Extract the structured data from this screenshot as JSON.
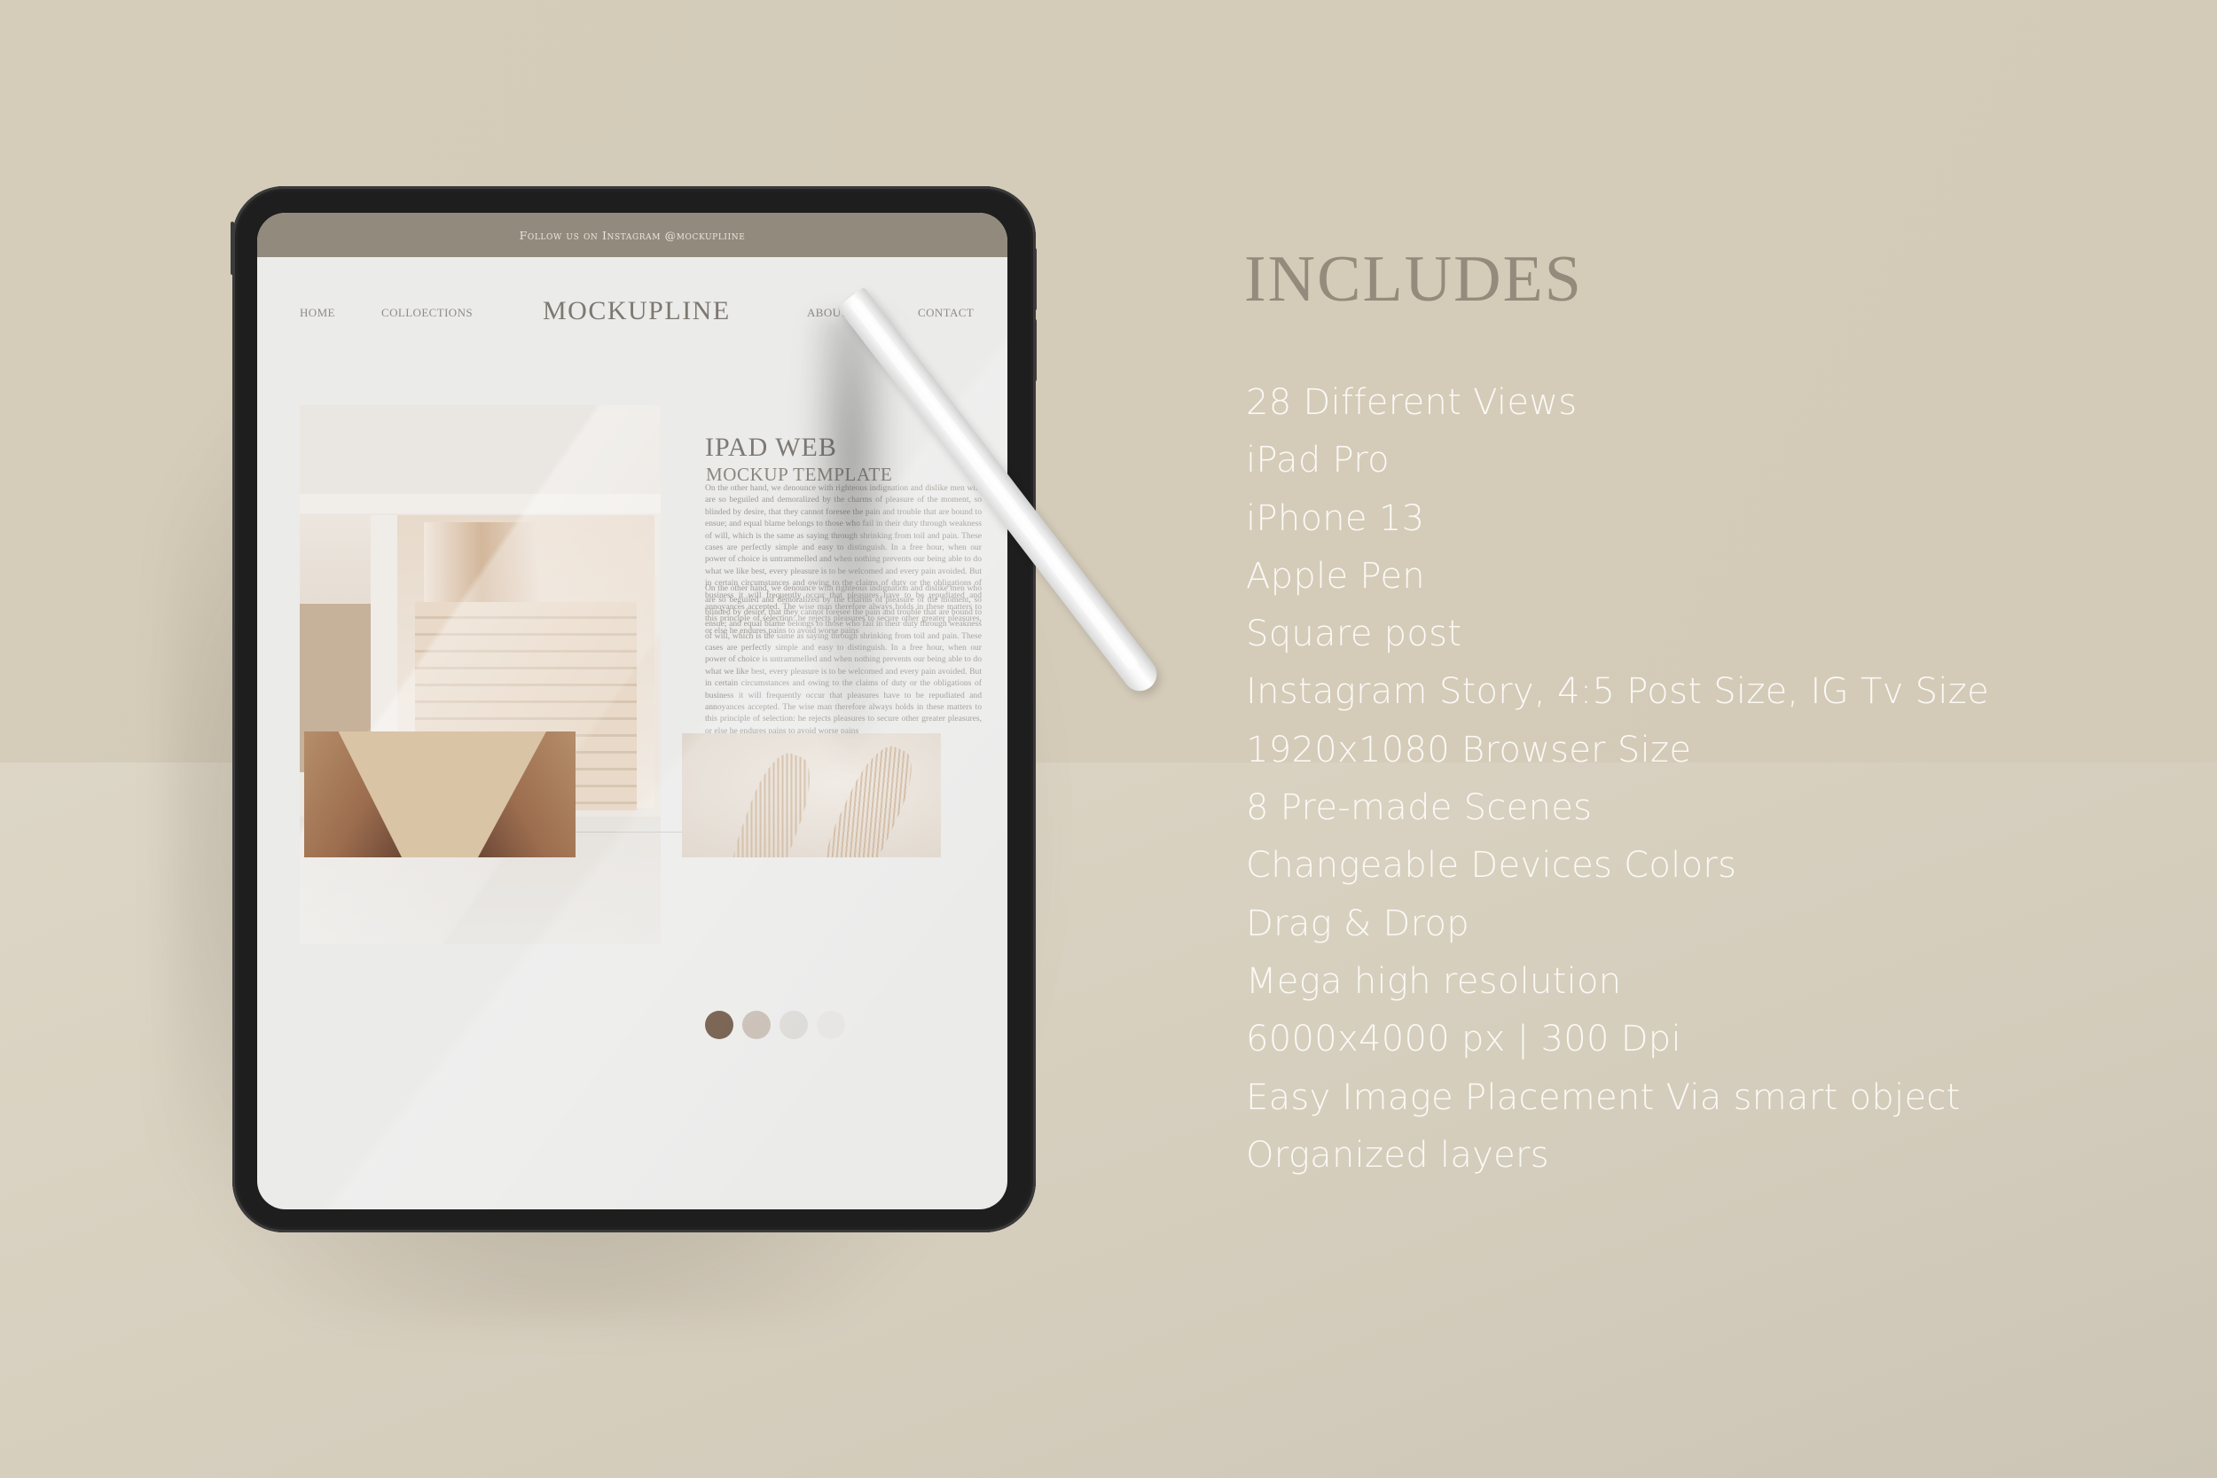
{
  "colors": {
    "background_top": "#d4cbb9",
    "background_bottom": "#ddd6c6",
    "device_frame": "#1e1e1e",
    "banner": "#928a7d",
    "title_text": "#948b7d",
    "feature_text": "#fbf9f5",
    "swatches": [
      "#6e5644",
      "#c7bdb3",
      "#dcdad6",
      "#e6e5e3"
    ]
  },
  "device": {
    "type": "iPad Pro",
    "website": {
      "banner_text": "Follow us on Instagram @mockupliine",
      "nav": {
        "left": [
          "HOME",
          "COLLOECTIONS"
        ],
        "logo": "MOCKUPLINE",
        "right": [
          "ABOUT US",
          "CONTACT"
        ]
      },
      "hero": {
        "title": "IPAD WEB",
        "subtitle": "MOCKUP TEMPLATE",
        "paragraphs": [
          "On the other hand, we denounce with righteous indignation and dislike men who are so beguiled and demoralized by the charms of pleasure of the moment, so blinded by desire, that they cannot foresee the pain and trouble that are bound to ensue; and equal blame belongs to those who fail in their duty through weakness of will, which is the same as saying through shrinking from toil and pain. These cases are perfectly simple and easy to distinguish. In a free hour, when our power of choice is untrammelled and when nothing prevents our being able to do what we like best, every pleasure is to be welcomed and every pain avoided. But in certain circumstances and owing to the claims of duty or the obligations of business it will frequently occur that pleasures have to be repudiated and annoyances accepted. The wise man therefore always holds in these matters to this principle of selection: he rejects pleasures to secure other greater pleasures, or else he endures pains to avoid worse pains",
          "On the other hand, we denounce with righteous indignation and dislike men who are so beguiled and demoralized by the charms of pleasure of the moment, so blinded by desire, that they cannot foresee the pain and trouble that are bound to ensue; and equal blame belongs to those who fail in their duty through weakness of will, which is the same as saying through shrinking from toil and pain. These cases are perfectly simple and easy to distinguish. In a free hour, when our power of choice is untrammelled and when nothing prevents our being able to do what we like best, every pleasure is to be welcomed and every pain avoided. But in certain circumstances and owing to the claims of duty or the obligations of business it will frequently occur that pleasures have to be repudiated and annoyances accepted. The wise man therefore always holds in these matters to this principle of selection: he rejects pleasures to secure other greater pleasures, or else he endures pains to avoid worse pains"
        ],
        "images": {
          "main": "staircase-photo",
          "bottom_left": "street-buildings-photo",
          "bottom_right": "pampas-grass-photo"
        }
      }
    },
    "accessory": "apple-pencil"
  },
  "includes": {
    "title": "INCLUDES",
    "items": [
      "28 Different Views",
      "iPad Pro",
      "iPhone 13",
      "Apple Pen",
      "Square post",
      "Instagram Story, 4:5 Post Size, IG Tv Size",
      "1920x1080 Browser Size",
      "8 Pre-made Scenes",
      "Changeable Devices Colors",
      "Drag & Drop",
      "Mega high resolution",
      "6000x4000 px | 300 Dpi",
      "Easy Image Placement Via smart object",
      "Organized layers"
    ]
  }
}
